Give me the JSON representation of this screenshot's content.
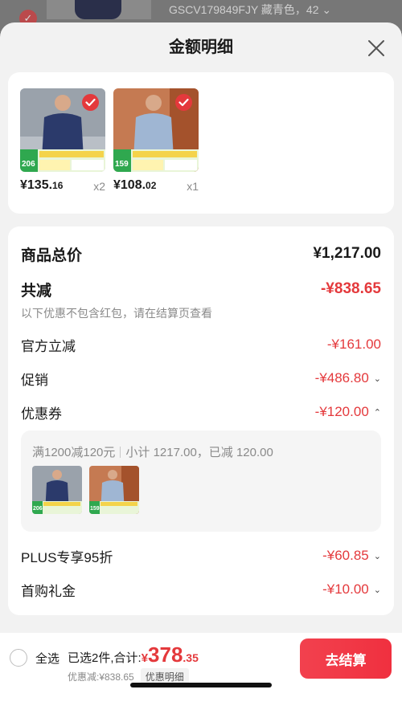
{
  "backdrop": {
    "variant_text": "GSCV179849FJY 藏青色，42 ⌄"
  },
  "sheet": {
    "title": "金额明细"
  },
  "items": [
    {
      "price_int": "¥135.",
      "price_dec": "16",
      "qty": "x2",
      "badge_num": "206"
    },
    {
      "price_int": "¥108.",
      "price_dec": "02",
      "qty": "x1",
      "badge_num": "159"
    }
  ],
  "summary": {
    "total_label": "商品总价",
    "total_value": "¥1,217.00",
    "discount_label": "共减",
    "discount_value": "-¥838.65",
    "discount_hint": "以下优惠不包含红包，请在结算页查看",
    "rows": [
      {
        "label": "官方立减",
        "value": "-¥161.00",
        "chevron": ""
      },
      {
        "label": "促销",
        "value": "-¥486.80",
        "chevron": "⌄"
      },
      {
        "label": "优惠券",
        "value": "-¥120.00",
        "chevron": "⌃"
      }
    ],
    "coupon": {
      "rule": "满1200减120元",
      "subtotal": "小计 1217.00，已减 120.00"
    },
    "rows2": [
      {
        "label": "PLUS专享95折",
        "value": "-¥60.85",
        "chevron": "⌄"
      },
      {
        "label": "首购礼金",
        "value": "-¥10.00",
        "chevron": "⌄"
      }
    ]
  },
  "footer": {
    "select_all": "全选",
    "selected_text": "已选2件,合计:",
    "currency": "¥",
    "amount_int": "378",
    "amount_dec": ".35",
    "saved_text": "优惠减:¥838.65",
    "detail_tag": "优惠明细",
    "checkout": "去结算"
  },
  "colors": {
    "accent": "#e4393c",
    "navy_shirt": "#2b3a6b",
    "light_shirt": "#9fb6d3"
  }
}
